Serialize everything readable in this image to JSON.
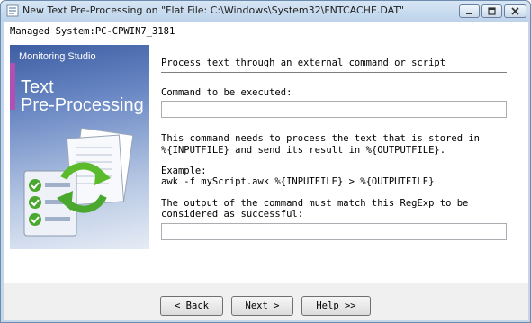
{
  "window": {
    "title": "New Text Pre-Processing on \"Flat File: C:\\Windows\\System32\\FNTCACHE.DAT\""
  },
  "header": {
    "managed_system": "Managed System:PC-CPWIN7_3181"
  },
  "banner": {
    "brand": "Monitoring Studio",
    "title_line1": "Text",
    "title_line2": "Pre-Processing"
  },
  "form": {
    "section_title": "Process text through an external command or script",
    "command_label": "Command to be executed:",
    "command_value": "",
    "description_line1": "This command needs to process the text that is stored in",
    "description_line2": "%{INPUTFILE} and send its result in %{OUTPUTFILE}.",
    "example_label": "Example:",
    "example_value": "awk -f myScript.awk %{INPUTFILE} > %{OUTPUTFILE}",
    "regexp_label_line1": "The output of the command must match this RegExp to be",
    "regexp_label_line2": "considered as successful:",
    "regexp_value": ""
  },
  "buttons": {
    "back": "< Back",
    "next": "Next >",
    "help": "Help >>"
  },
  "colors": {
    "title_bar": "#c3d6ea",
    "banner_accent": "#b24fb3",
    "banner_blue": "#3d5ea3",
    "check_green": "#4aa82e"
  }
}
